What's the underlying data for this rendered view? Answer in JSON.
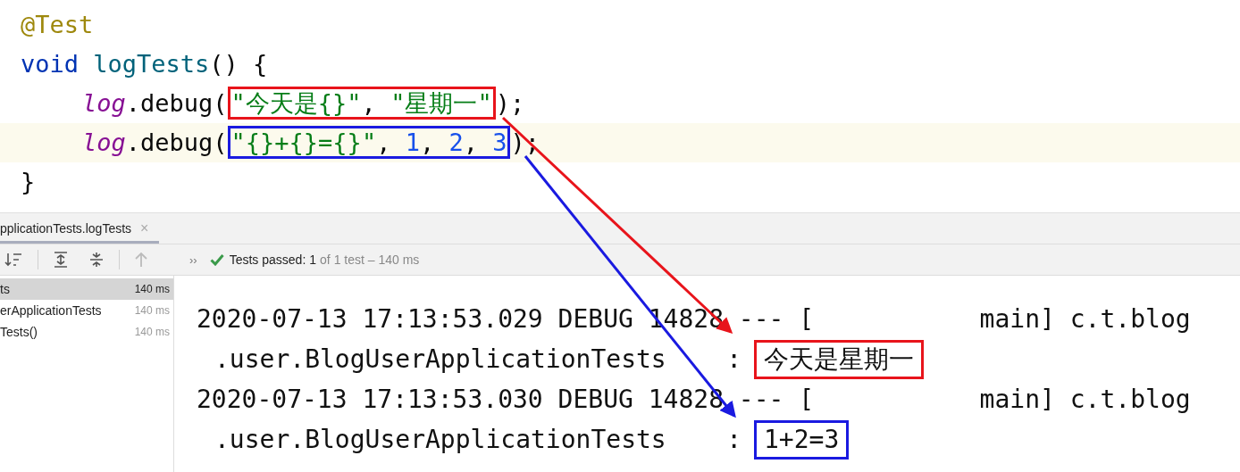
{
  "code": {
    "lines": [
      {
        "highlighted": false,
        "indented": false,
        "segments": [
          {
            "kind": "annotation",
            "text": "@Test"
          }
        ]
      },
      {
        "highlighted": false,
        "indented": false,
        "segments": [
          {
            "kind": "keyword",
            "text": "void "
          },
          {
            "kind": "method",
            "text": "logTests"
          },
          {
            "kind": "plain",
            "text": "() {"
          }
        ]
      },
      {
        "highlighted": false,
        "indented": true,
        "segments": [
          {
            "kind": "field",
            "text": "log"
          },
          {
            "kind": "plain",
            "text": ".debug("
          },
          {
            "kind": "box",
            "color": "#e8141b",
            "children": [
              {
                "kind": "string",
                "text": "\"今天是{}\""
              },
              {
                "kind": "plain",
                "text": ", "
              },
              {
                "kind": "string",
                "text": "\"星期一\""
              }
            ]
          },
          {
            "kind": "plain",
            "text": ");"
          }
        ]
      },
      {
        "highlighted": true,
        "indented": true,
        "segments": [
          {
            "kind": "field",
            "text": "log"
          },
          {
            "kind": "plain",
            "text": ".debug("
          },
          {
            "kind": "box",
            "color": "#1a1ae0",
            "children": [
              {
                "kind": "string",
                "text": "\"{}+{}={}\""
              },
              {
                "kind": "plain",
                "text": ", "
              },
              {
                "kind": "number",
                "text": "1"
              },
              {
                "kind": "plain",
                "text": ", "
              },
              {
                "kind": "number",
                "text": "2"
              },
              {
                "kind": "plain",
                "text": ", "
              },
              {
                "kind": "number",
                "text": "3"
              }
            ]
          },
          {
            "kind": "plain",
            "text": ");"
          }
        ]
      },
      {
        "highlighted": false,
        "indented": false,
        "segments": [
          {
            "kind": "plain",
            "text": "}"
          }
        ]
      }
    ]
  },
  "run_panel": {
    "tab": {
      "label": "pplicationTests.logTests",
      "close": "×",
      "selected": true
    },
    "toolbar": {
      "more": "››",
      "status_label": "Tests passed:",
      "status_count": "1",
      "status_rest": "of 1 test – 140 ms"
    },
    "tree": [
      {
        "name": "ts",
        "time": "140 ms",
        "selected": true
      },
      {
        "name": "erApplicationTests",
        "time": "140 ms",
        "selected": false
      },
      {
        "name": "Tests()",
        "time": "140 ms",
        "selected": false
      }
    ],
    "console": [
      {
        "kind": "head",
        "text": "2020-07-13 17:13:53.029 DEBUG 14828 --- [           main] c.t.blog"
      },
      {
        "kind": "message",
        "prefix": ".user.BlogUserApplicationTests    :",
        "message": "今天是星期一",
        "color": "#e8141b"
      },
      {
        "kind": "head",
        "text": "2020-07-13 17:13:53.030 DEBUG 14828 --- [           main] c.t.blog"
      },
      {
        "kind": "message",
        "prefix": ".user.BlogUserApplicationTests    :",
        "message": "1+2=3",
        "color": "#1a1ae0"
      }
    ]
  },
  "arrows": [
    {
      "color": "#e8141b"
    },
    {
      "color": "#1a1ae0"
    }
  ]
}
